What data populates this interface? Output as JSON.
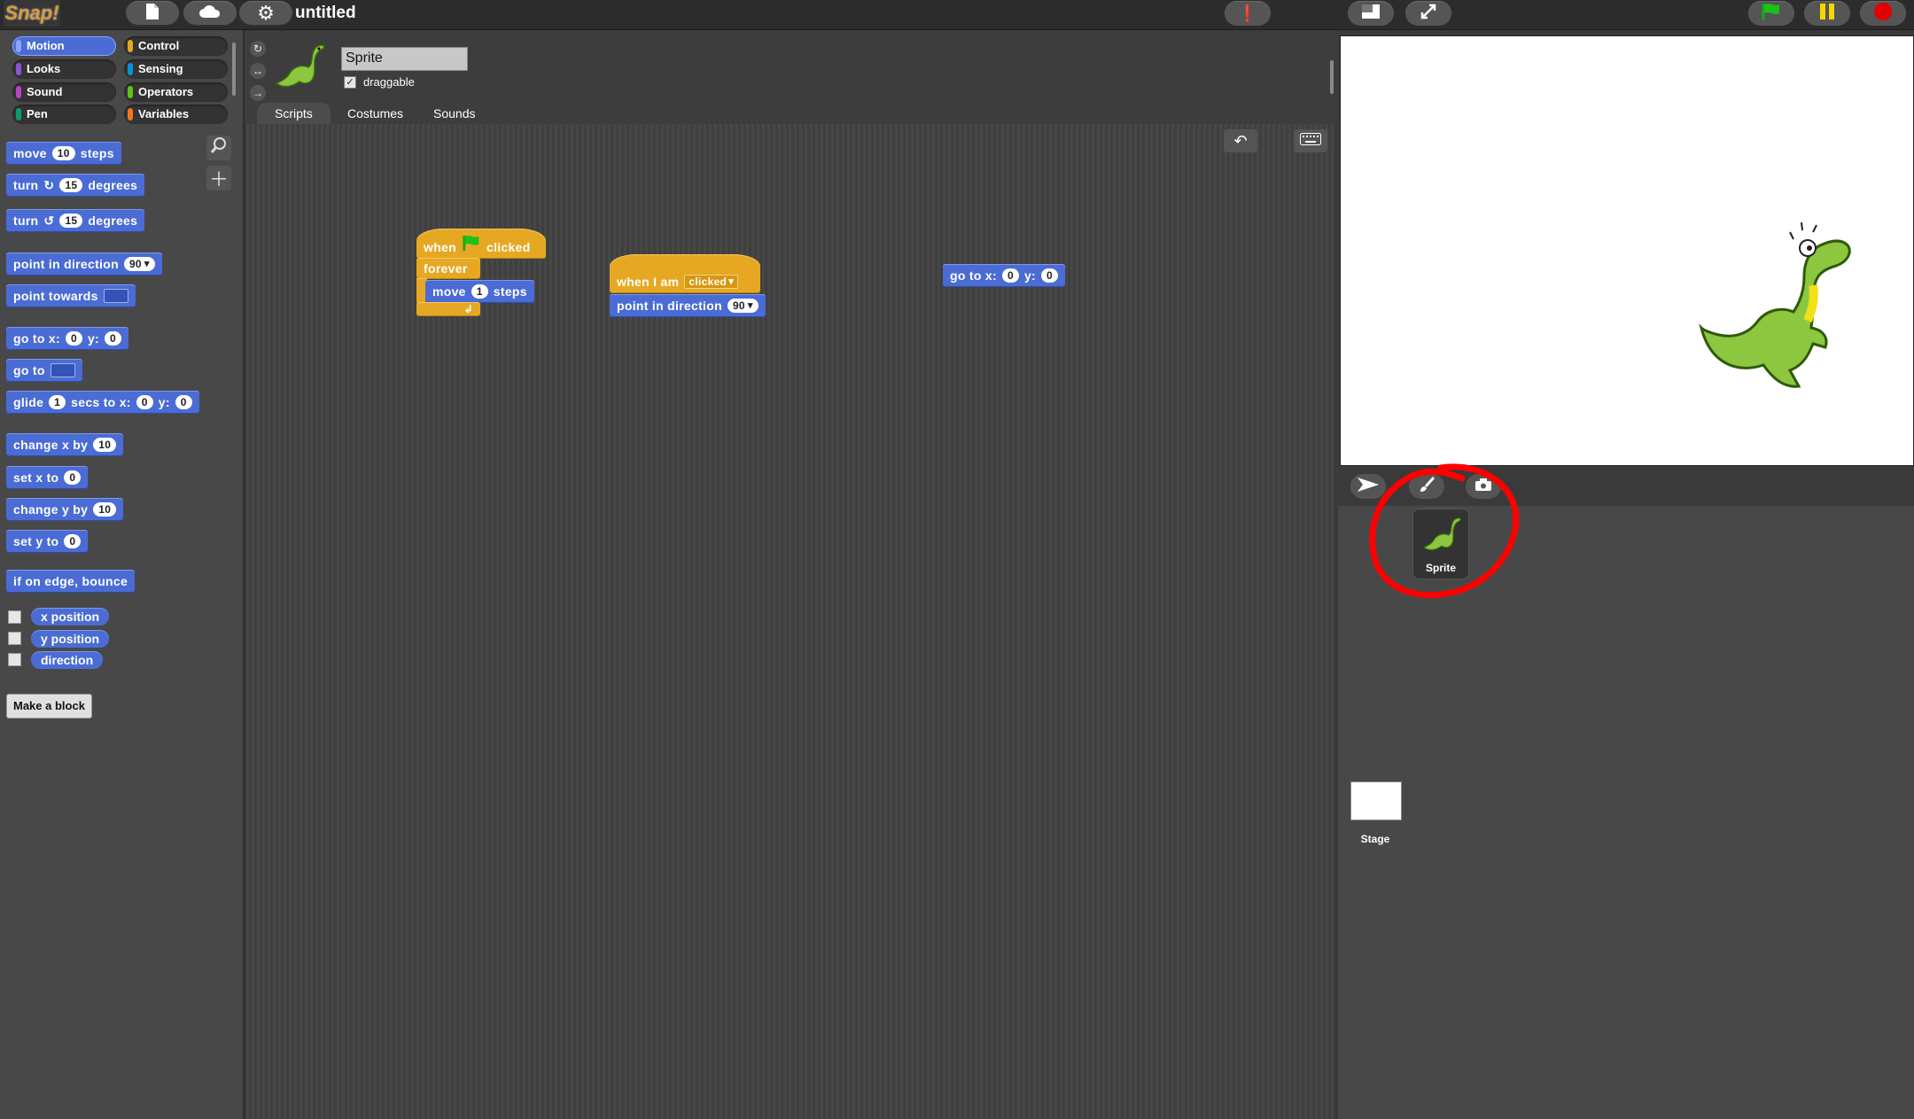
{
  "app": {
    "logo": "Snap!",
    "project_title": "untitled"
  },
  "categories": [
    {
      "label": "Motion",
      "color": "#4a6cd4",
      "active": true
    },
    {
      "label": "Looks",
      "color": "#8a55d7"
    },
    {
      "label": "Sound",
      "color": "#bb42c3"
    },
    {
      "label": "Pen",
      "color": "#0e9a6c"
    },
    {
      "label": "Control",
      "color": "#e6a822"
    },
    {
      "label": "Sensing",
      "color": "#0494dc"
    },
    {
      "label": "Operators",
      "color": "#62c213"
    },
    {
      "label": "Variables",
      "color": "#f3761d"
    }
  ],
  "palette": {
    "move": {
      "a": "move",
      "v": "10",
      "b": "steps"
    },
    "turn_cw": {
      "a": "turn",
      "v": "15",
      "b": "degrees"
    },
    "turn_ccw": {
      "a": "turn",
      "v": "15",
      "b": "degrees"
    },
    "point_dir": {
      "a": "point in direction",
      "v": "90"
    },
    "point_towards": {
      "a": "point towards"
    },
    "goto_xy": {
      "a": "go to x:",
      "x": "0",
      "b": "y:",
      "y": "0"
    },
    "goto": {
      "a": "go to"
    },
    "glide": {
      "a": "glide",
      "v": "1",
      "b": "secs to x:",
      "x": "0",
      "c": "y:",
      "y": "0"
    },
    "change_x": {
      "a": "change x by",
      "v": "10"
    },
    "set_x": {
      "a": "set x to",
      "v": "0"
    },
    "change_y": {
      "a": "change y by",
      "v": "10"
    },
    "set_y": {
      "a": "set y to",
      "v": "0"
    },
    "bounce": {
      "a": "if on edge, bounce"
    },
    "reporters": [
      "x position",
      "y position",
      "direction"
    ],
    "make_block": "Make a block"
  },
  "sprite": {
    "name": "Sprite",
    "draggable_label": "draggable"
  },
  "tabs": [
    "Scripts",
    "Costumes",
    "Sounds"
  ],
  "scripts": {
    "s1": {
      "when": "when",
      "clicked": "clicked",
      "forever": "forever",
      "move": "move",
      "steps_value": "1",
      "steps": "steps"
    },
    "s2": {
      "when": "when I am",
      "event": "clicked",
      "point": "point in direction",
      "dir_value": "90"
    },
    "s3": {
      "goto": "go to x:",
      "x": "0",
      "y_label": "y:",
      "y": "0"
    }
  },
  "corral": {
    "sprite_label": "Sprite",
    "stage_label": "Stage"
  }
}
